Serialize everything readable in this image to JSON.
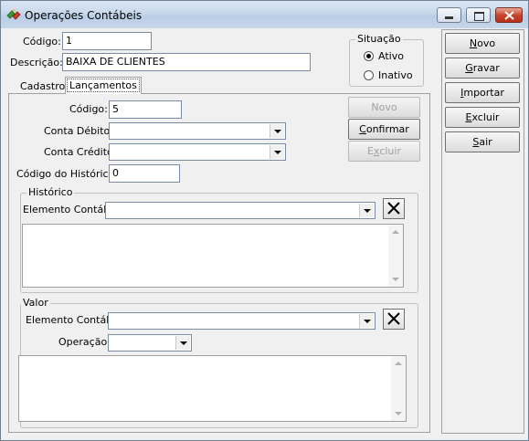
{
  "window": {
    "title": "Operações Contábeis"
  },
  "header": {
    "codigo_label": "Código:",
    "codigo_value": "1",
    "descricao_label": "Descrição:",
    "descricao_value": "BAIXA DE CLIENTES"
  },
  "situacao": {
    "legend": "Situação",
    "options": [
      {
        "label": "Ativo",
        "checked": true
      },
      {
        "label": "Inativo",
        "checked": false
      }
    ]
  },
  "tabs": [
    {
      "label": "Cadastro",
      "active": false
    },
    {
      "label": "Lançamentos",
      "active": true
    }
  ],
  "lancamentos": {
    "codigo_label": "Código:",
    "codigo_value": "5",
    "conta_debito_label": "Conta Débito:",
    "conta_debito_value": "",
    "conta_credito_label": "Conta Crédito:",
    "conta_credito_value": "",
    "codigo_historico_label": "Código do Histórico:",
    "codigo_historico_value": "0",
    "buttons": {
      "novo": "Novo",
      "confirmar": "Confirmar",
      "excluir": "Excluir"
    }
  },
  "historico": {
    "legend": "Histórico",
    "elemento_label": "Elemento Contábil:",
    "elemento_value": "",
    "clear_icon": "close-x-icon"
  },
  "valor": {
    "legend": "Valor",
    "elemento_label": "Elemento Contábil:",
    "elemento_value": "",
    "operacao_label": "Operação:",
    "operacao_value": "",
    "clear_icon": "close-x-icon"
  },
  "side_buttons": {
    "novo": "Novo",
    "gravar": "Gravar",
    "importar": "Importar",
    "excluir": "Excluir",
    "sair": "Sair"
  }
}
